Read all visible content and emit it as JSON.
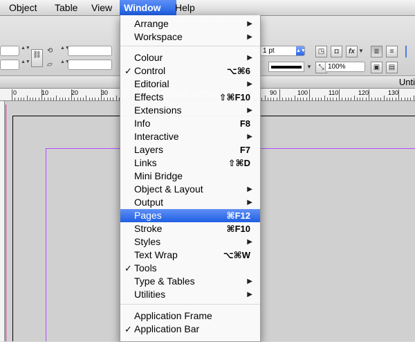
{
  "menubar": {
    "items": [
      {
        "label": "Object"
      },
      {
        "label": "Table"
      },
      {
        "label": "View"
      },
      {
        "label": "Window"
      },
      {
        "label": "Help"
      }
    ]
  },
  "control_panel": {
    "stroke_weight": "1 pt",
    "zoom": "100%"
  },
  "document": {
    "title": "Unti"
  },
  "ruler": {
    "labels": [
      "0",
      "10",
      "20",
      "30",
      "40",
      "90",
      "100",
      "110",
      "120",
      "130"
    ]
  },
  "window_menu": {
    "items": [
      {
        "label": "Arrange",
        "submenu": true
      },
      {
        "label": "Workspace",
        "submenu": true
      },
      {
        "label": "Colour",
        "submenu": true
      },
      {
        "label": "Control",
        "checked": true,
        "shortcut": "⌥⌘6"
      },
      {
        "label": "Editorial",
        "submenu": true
      },
      {
        "label": "Effects",
        "shortcut": "⇧⌘F10"
      },
      {
        "label": "Extensions",
        "submenu": true
      },
      {
        "label": "Info",
        "shortcut": "F8"
      },
      {
        "label": "Interactive",
        "submenu": true
      },
      {
        "label": "Layers",
        "shortcut": "F7"
      },
      {
        "label": "Links",
        "shortcut": "⇧⌘D"
      },
      {
        "label": "Mini Bridge"
      },
      {
        "label": "Object & Layout",
        "submenu": true
      },
      {
        "label": "Output",
        "submenu": true
      },
      {
        "label": "Pages",
        "shortcut": "⌘F12",
        "highlighted": true
      },
      {
        "label": "Stroke",
        "shortcut": "⌘F10"
      },
      {
        "label": "Styles",
        "submenu": true
      },
      {
        "label": "Text Wrap",
        "shortcut": "⌥⌘W"
      },
      {
        "label": "Tools",
        "checked": true
      },
      {
        "label": "Type & Tables",
        "submenu": true
      },
      {
        "label": "Utilities",
        "submenu": true
      },
      {
        "label": "Application Frame"
      },
      {
        "label": "Application Bar",
        "checked": true
      }
    ],
    "check_glyph": "✓",
    "submenu_glyph": "▶"
  },
  "colors": {
    "highlight": "#2f6cf0",
    "bleed_guide": "#e0179b",
    "margin_guide": "#b04bff"
  }
}
